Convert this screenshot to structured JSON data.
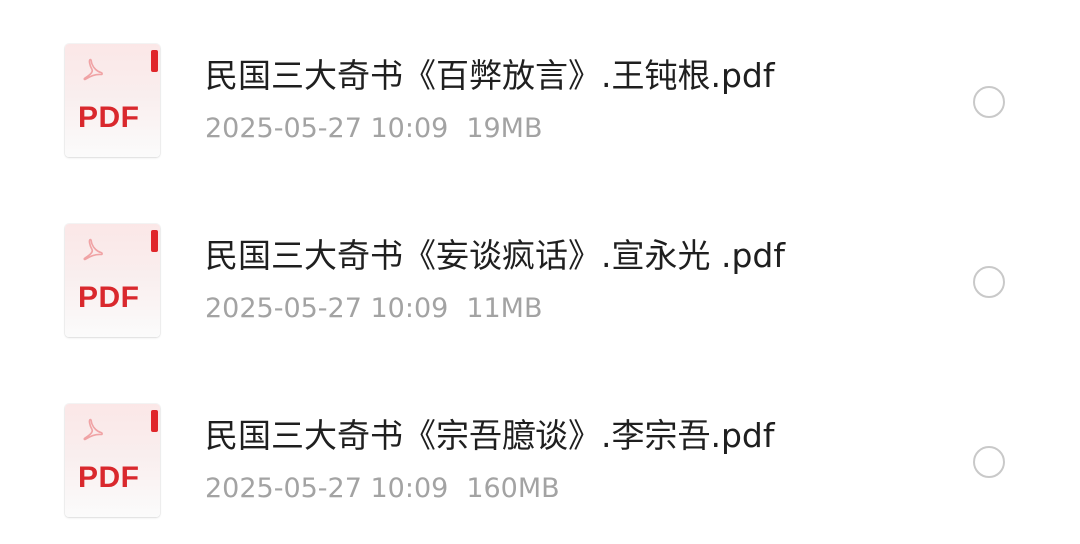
{
  "files": [
    {
      "name": "民国三大奇书《百弊放言》.王钝根.pdf",
      "date": "2025-05-27 10:09",
      "size": "19MB",
      "icon": "pdf-file-icon",
      "icon_label": "PDF"
    },
    {
      "name": "民国三大奇书《妄谈疯话》.宣永光 .pdf",
      "date": "2025-05-27 10:09",
      "size": "11MB",
      "icon": "pdf-file-icon",
      "icon_label": "PDF"
    },
    {
      "name": "民国三大奇书《宗吾臆谈》.李宗吾.pdf",
      "date": "2025-05-27 10:09",
      "size": "160MB",
      "icon": "pdf-file-icon",
      "icon_label": "PDF"
    }
  ],
  "colors": {
    "pdf_red": "#d9282d",
    "name_text": "#1f1f1f",
    "meta_text": "#a3a3a3",
    "radio_border": "#c9c9c9"
  }
}
